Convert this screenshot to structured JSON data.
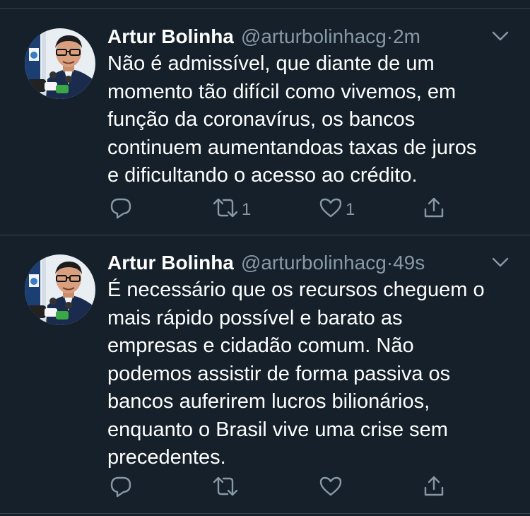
{
  "colors": {
    "background": "#15202b",
    "divider": "#38444d",
    "text_primary": "#ffffff",
    "text_secondary": "#8899a6"
  },
  "tweets": [
    {
      "name": "Artur Bolinha",
      "handle": "@arturbolinhacg",
      "dot": "·",
      "time": "2m",
      "lines": [
        "Não é admissível, que diante de um",
        "momento tão difícil como vivemos, em",
        "função da coronavírus, os bancos",
        "continuem aumentandoas taxas de juros",
        "e dificultando o acesso ao crédito."
      ],
      "actions": {
        "reply_icon": "reply-icon",
        "retweet_icon": "retweet-icon",
        "retweet_count": "1",
        "like_icon": "heart-icon",
        "like_count": "1",
        "share_icon": "share-icon"
      }
    },
    {
      "name": "Artur Bolinha",
      "handle": "@arturbolinhacg",
      "dot": "·",
      "time": "49s",
      "lines": [
        "É necessário que os recursos cheguem o",
        "mais rápido possível e barato as",
        "empresas e cidadão comum. Não",
        "podemos assistir de forma passiva os",
        "bancos auferirem lucros bilionários,",
        "enquanto o Brasil vive uma crise sem",
        "precedentes."
      ],
      "actions": {
        "reply_icon": "reply-icon",
        "retweet_icon": "retweet-icon",
        "retweet_count": "",
        "like_icon": "heart-icon",
        "like_count": "",
        "share_icon": "share-icon"
      }
    }
  ]
}
